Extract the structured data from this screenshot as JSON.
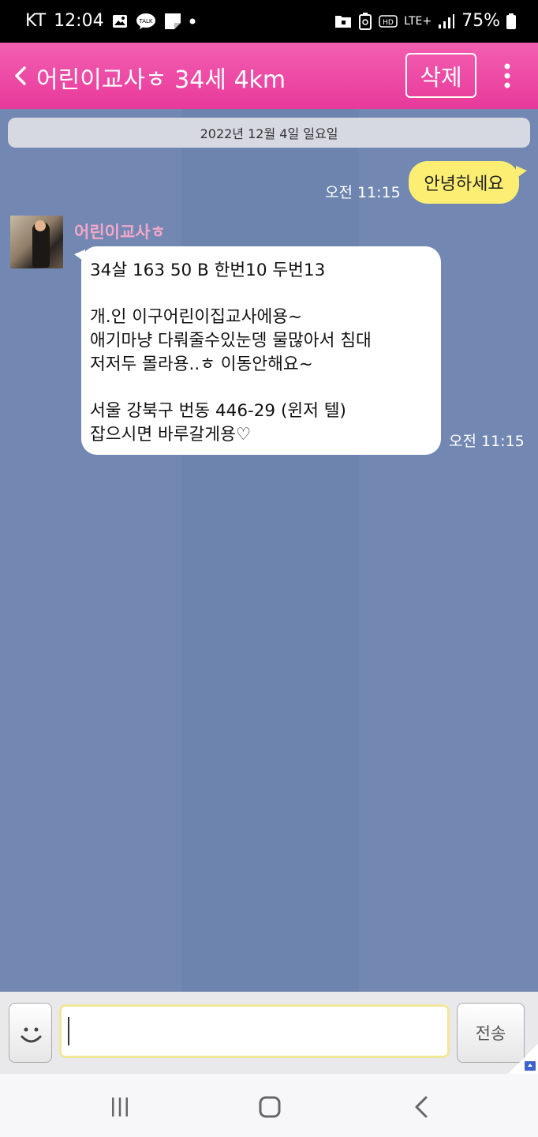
{
  "status_bar": {
    "carrier": "KT",
    "time": "12:04",
    "battery": "75%",
    "network": "LTE+"
  },
  "header": {
    "title": "어린이교사ㅎ 34세 4km",
    "delete_label": "삭제"
  },
  "chat": {
    "date": "2022년 12월 4일 일요일",
    "outgoing": {
      "text": "안녕하세요",
      "time": "오전 11:15"
    },
    "incoming": {
      "sender": "어린이교사ㅎ",
      "lines": [
        "34살 163 50 B 한번10 두번13",
        "",
        "개.인 이구어린이집교사에용~",
        "애기마냥 다뤄줄수있눈뎅 물많아서 침대",
        "저저두 몰라용..ㅎ 이동안해요~",
        "",
        "서울 강북구 번동 446-29 (윈저 텔)",
        "잡으시면 바루갈게용♡"
      ],
      "time": "오전 11:15"
    }
  },
  "input": {
    "value": "",
    "send_label": "전송"
  },
  "colors": {
    "header": "#e8399a",
    "chat_bg": "#7286b0",
    "my_bubble": "#fbee73",
    "sender_name": "#f3a7c8"
  }
}
